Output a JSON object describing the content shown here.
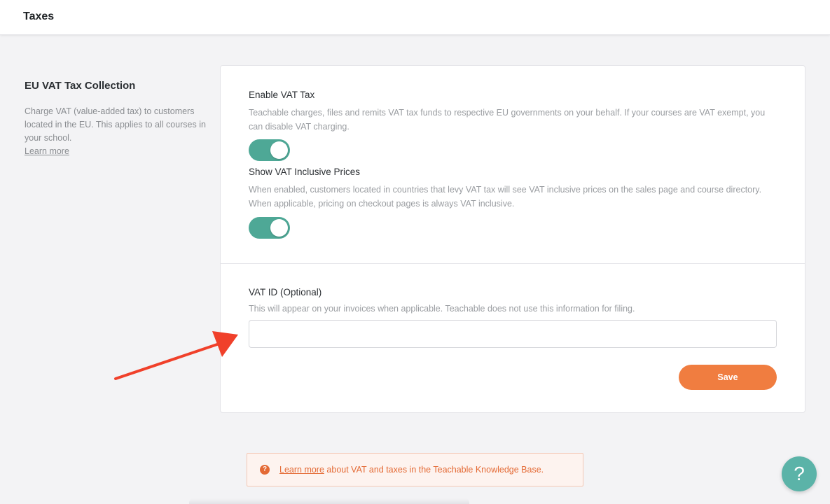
{
  "header": {
    "title": "Taxes"
  },
  "sidebar": {
    "heading": "EU VAT Tax Collection",
    "description": "Charge VAT (value-added tax) to customers located in the EU. This applies to all courses in your school.",
    "learn_more": "Learn more"
  },
  "settings": {
    "enable_vat": {
      "label": "Enable VAT Tax",
      "help": "Teachable charges, files and remits VAT tax funds to respective EU governments on your behalf. If your courses are VAT exempt, you can disable VAT charging.",
      "enabled": true
    },
    "inclusive_prices": {
      "label": "Show VAT Inclusive Prices",
      "help": "When enabled, customers located in countries that levy VAT tax will see VAT inclusive prices on the sales page and course directory. When applicable, pricing on checkout pages is always VAT inclusive.",
      "enabled": true
    },
    "vat_id": {
      "label": "VAT ID (Optional)",
      "help": "This will appear on your invoices when applicable. Teachable does not use this information for filing.",
      "value": "",
      "placeholder": ""
    },
    "save_label": "Save"
  },
  "kb_banner": {
    "link_text": "Learn more",
    "text": " about VAT and taxes in the Teachable Knowledge Base.",
    "icon": "question-circle-icon"
  },
  "help_button": {
    "glyph": "?",
    "icon": "help-icon"
  },
  "colors": {
    "toggle_on": "#4ea896",
    "save_button": "#f07d40",
    "banner_text": "#e46a35",
    "help_fab": "#5bb3a8",
    "annotation_arrow": "#f0402a"
  }
}
